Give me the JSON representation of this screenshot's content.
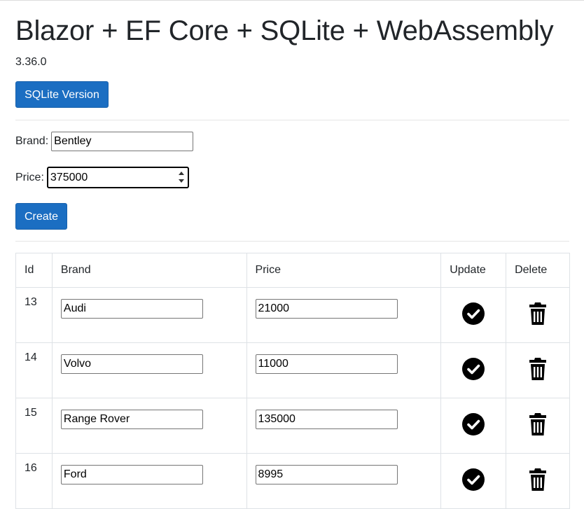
{
  "header": {
    "title": "Blazor + EF Core + SQLite + WebAssembly",
    "version": "3.36.0",
    "sqlite_button": "SQLite Version"
  },
  "form": {
    "brand_label": "Brand:",
    "brand_value": "Bentley",
    "price_label": "Price:",
    "price_value": "375000",
    "create_button": "Create"
  },
  "table": {
    "columns": [
      "Id",
      "Brand",
      "Price",
      "Update",
      "Delete"
    ],
    "rows": [
      {
        "id": "13",
        "brand": "Audi",
        "price": "21000"
      },
      {
        "id": "14",
        "brand": "Volvo",
        "price": "11000"
      },
      {
        "id": "15",
        "brand": "Range Rover",
        "price": "135000"
      },
      {
        "id": "16",
        "brand": "Ford",
        "price": "8995"
      }
    ],
    "update_icon": "check-circle-icon",
    "delete_icon": "trash-icon"
  },
  "colors": {
    "primary_button": "#1b6ec2",
    "icon": "#000000"
  }
}
